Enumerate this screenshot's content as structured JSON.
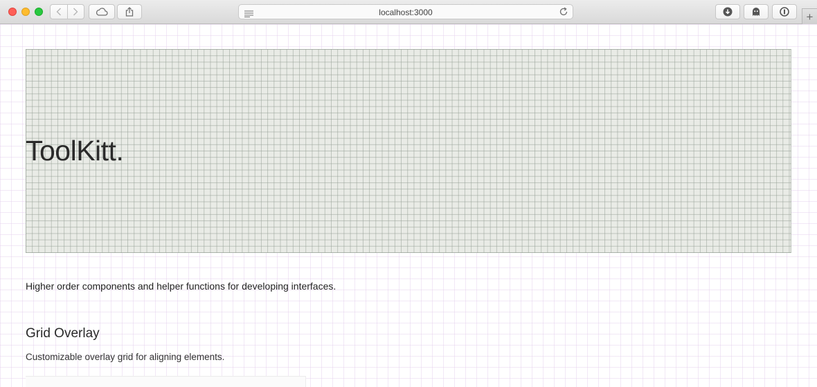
{
  "browser": {
    "url": "localhost:3000",
    "new_tab_label": "+"
  },
  "page": {
    "hero_title": "ToolKitt.",
    "tagline": "Higher order components and helper functions for developing interfaces.",
    "section": {
      "heading": "Grid Overlay",
      "description": "Customizable overlay grid for aligning elements."
    }
  },
  "colors": {
    "hero_background": "#e9ebe6",
    "hero_grid_line": "#969f96",
    "page_grid_line": "#e1cdeb"
  },
  "icons": [
    "back-icon",
    "forward-icon",
    "cloud-icon",
    "share-icon",
    "reader-icon",
    "reload-icon",
    "download-icon",
    "ghostery-icon",
    "info-icon"
  ]
}
